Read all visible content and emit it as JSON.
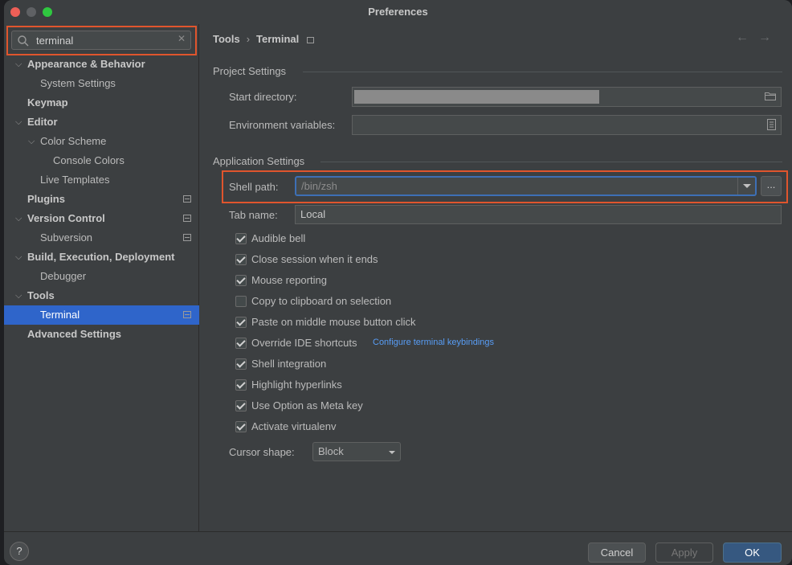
{
  "window": {
    "title": "Preferences"
  },
  "search": {
    "value": "terminal",
    "placeholder": ""
  },
  "sidebar": {
    "items": [
      {
        "label": "Appearance & Behavior",
        "level": 0,
        "expanded": true,
        "bold": true
      },
      {
        "label": "System Settings",
        "level": 1
      },
      {
        "label": "Keymap",
        "level": 0,
        "bold": true
      },
      {
        "label": "Editor",
        "level": 0,
        "expanded": true,
        "bold": true
      },
      {
        "label": "Color Scheme",
        "level": 1,
        "expanded": true
      },
      {
        "label": "Console Colors",
        "level": 2
      },
      {
        "label": "Live Templates",
        "level": 1
      },
      {
        "label": "Plugins",
        "level": 0,
        "bold": true,
        "project_icon": true
      },
      {
        "label": "Version Control",
        "level": 0,
        "expanded": true,
        "bold": true,
        "project_icon": true
      },
      {
        "label": "Subversion",
        "level": 1,
        "project_icon": true
      },
      {
        "label": "Build, Execution, Deployment",
        "level": 0,
        "expanded": true,
        "bold": true
      },
      {
        "label": "Debugger",
        "level": 1
      },
      {
        "label": "Tools",
        "level": 0,
        "expanded": true,
        "bold": true
      },
      {
        "label": "Terminal",
        "level": 1,
        "selected": true,
        "project_icon": true
      },
      {
        "label": "Advanced Settings",
        "level": 0,
        "bold": true
      }
    ]
  },
  "breadcrumb": {
    "parent": "Tools",
    "separator": "›",
    "current": "Terminal"
  },
  "nav": {
    "back": "←",
    "forward": "→"
  },
  "project_settings": {
    "title": "Project Settings",
    "start_directory_label": "Start directory:",
    "environment_variables_label": "Environment variables:",
    "environment_variables_value": ""
  },
  "application_settings": {
    "title": "Application Settings",
    "shell_path_label": "Shell path:",
    "shell_path_value": "/bin/zsh",
    "browse_label": "...",
    "tab_name_label": "Tab name:",
    "tab_name_value": "Local",
    "checkboxes": [
      {
        "label": "Audible bell",
        "checked": true
      },
      {
        "label": "Close session when it ends",
        "checked": true
      },
      {
        "label": "Mouse reporting",
        "checked": true
      },
      {
        "label": "Copy to clipboard on selection",
        "checked": false
      },
      {
        "label": "Paste on middle mouse button click",
        "checked": true
      },
      {
        "label": "Override IDE shortcuts",
        "checked": true
      },
      {
        "label": "Shell integration",
        "checked": true
      },
      {
        "label": "Highlight hyperlinks",
        "checked": true
      },
      {
        "label": "Use Option as Meta key",
        "checked": true
      },
      {
        "label": "Activate virtualenv",
        "checked": true
      }
    ],
    "keybindings_link": "Configure terminal keybindings",
    "cursor_shape_label": "Cursor shape:",
    "cursor_shape_value": "Block"
  },
  "footer": {
    "help_label": "?",
    "cancel_label": "Cancel",
    "apply_label": "Apply",
    "ok_label": "OK"
  },
  "colors": {
    "highlight_border": "#e0552d",
    "selection": "#2f65ca",
    "link": "#589df6",
    "ok_button": "#365880"
  }
}
